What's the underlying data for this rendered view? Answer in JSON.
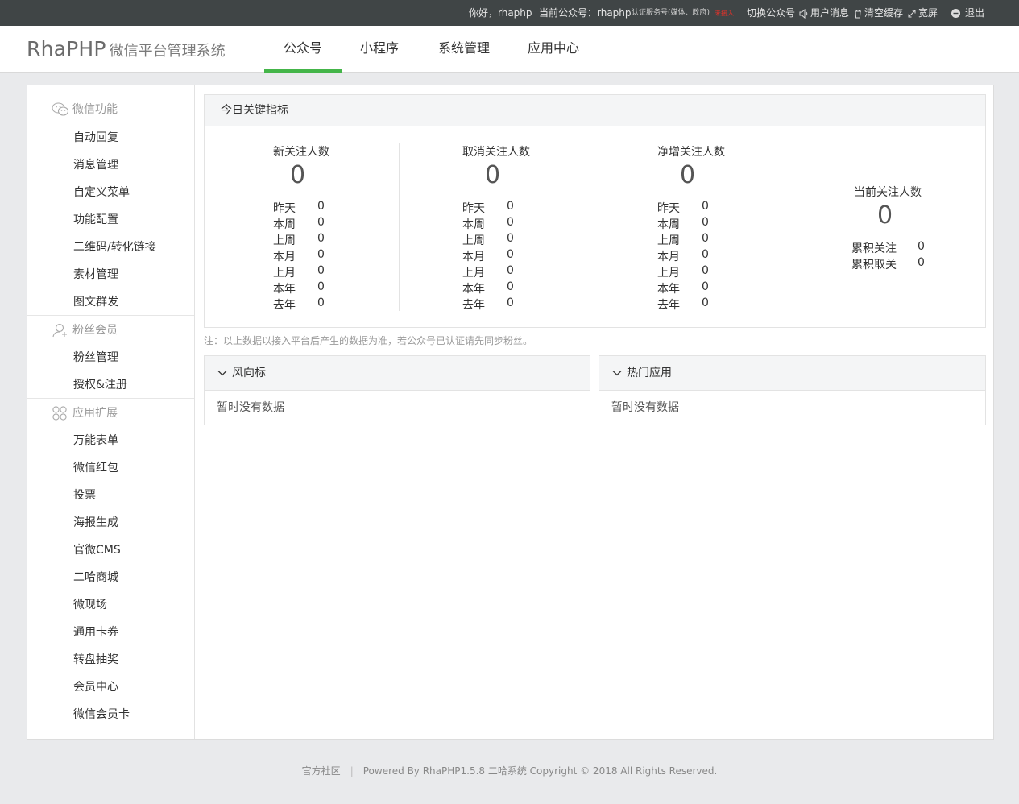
{
  "topbar": {
    "greeting": "你好，rhaphp",
    "current_label": "当前公众号：rhaphp",
    "account_type": "认证服务号(媒体、政府)",
    "status": "未接入",
    "switch": "切换公众号",
    "messages": "用户消息",
    "clear_cache": "清空缓存",
    "widescreen": "宽屏",
    "logout": "退出"
  },
  "header": {
    "brand": "RhaPHP",
    "subtitle": "微信平台管理系统",
    "tabs": [
      "公众号",
      "小程序",
      "系统管理",
      "应用中心"
    ],
    "active_tab": "公众号",
    "accent_color": "#44b549"
  },
  "sidebar": {
    "groups": [
      {
        "title": "微信功能",
        "icon": "wechat-icon",
        "items": [
          "自动回复",
          "消息管理",
          "自定义菜单",
          "功能配置",
          "二维码/转化链接",
          "素材管理",
          "图文群发"
        ]
      },
      {
        "title": "粉丝会员",
        "icon": "user-icon",
        "items": [
          "粉丝管理",
          "授权&注册"
        ]
      },
      {
        "title": "应用扩展",
        "icon": "apps-icon",
        "items": [
          "万能表单",
          "微信红包",
          "投票",
          "海报生成",
          "官微CMS",
          "二哈商城",
          "微现场",
          "通用卡券",
          "转盘抽奖",
          "会员中心",
          "微信会员卡"
        ]
      }
    ]
  },
  "kpi": {
    "title": "今日关键指标",
    "columns": [
      {
        "title": "新关注人数",
        "value": "0",
        "rows": [
          [
            "昨天",
            "0"
          ],
          [
            "本周",
            "0"
          ],
          [
            "上周",
            "0"
          ],
          [
            "本月",
            "0"
          ],
          [
            "上月",
            "0"
          ],
          [
            "本年",
            "0"
          ],
          [
            "去年",
            "0"
          ]
        ]
      },
      {
        "title": "取消关注人数",
        "value": "0",
        "rows": [
          [
            "昨天",
            "0"
          ],
          [
            "本周",
            "0"
          ],
          [
            "上周",
            "0"
          ],
          [
            "本月",
            "0"
          ],
          [
            "上月",
            "0"
          ],
          [
            "本年",
            "0"
          ],
          [
            "去年",
            "0"
          ]
        ]
      },
      {
        "title": "净增关注人数",
        "value": "0",
        "rows": [
          [
            "昨天",
            "0"
          ],
          [
            "本周",
            "0"
          ],
          [
            "上周",
            "0"
          ],
          [
            "本月",
            "0"
          ],
          [
            "上月",
            "0"
          ],
          [
            "本年",
            "0"
          ],
          [
            "去年",
            "0"
          ]
        ]
      },
      {
        "title": "当前关注人数",
        "value": "0",
        "rows": [
          [
            "累积关注",
            "0"
          ],
          [
            "累积取关",
            "0"
          ]
        ]
      }
    ],
    "note": "注：以上数据以接入平台后产生的数据为准，若公众号已认证请先同步粉丝。"
  },
  "cards": [
    {
      "title": "风向标",
      "empty": "暂时没有数据"
    },
    {
      "title": "热门应用",
      "empty": "暂时没有数据"
    }
  ],
  "footer": {
    "community": "官方社区",
    "powered": "Powered By RhaPHP1.5.8 二哈系统 Copyright © 2018 All Rights Reserved."
  }
}
